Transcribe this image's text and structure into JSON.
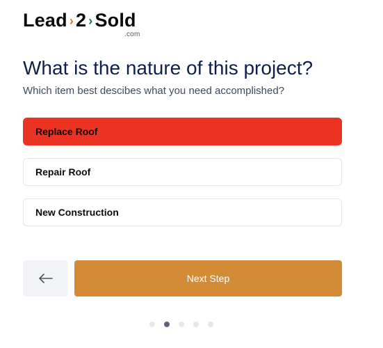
{
  "logo": {
    "part1": "Lead",
    "part2": "2",
    "part3": "Sold",
    "suffix": ".com",
    "colors": {
      "chevron_left": "#e07a1f",
      "chevron_right": "#1e6b4f"
    }
  },
  "question": {
    "title": "What is the nature of this project?",
    "subtitle": "Which item best descibes what you need accomplished?"
  },
  "options": [
    {
      "label": "Replace Roof",
      "selected": true
    },
    {
      "label": "Repair Roof",
      "selected": false
    },
    {
      "label": "New Construction",
      "selected": false
    }
  ],
  "navigation": {
    "back_icon": "arrow-left-icon",
    "next_label": "Next Step"
  },
  "progress": {
    "total_steps": 5,
    "current_step": 2
  },
  "colors": {
    "selected_option": "#eb3323",
    "next_button": "#d48b35",
    "title": "#0f1f4a"
  }
}
